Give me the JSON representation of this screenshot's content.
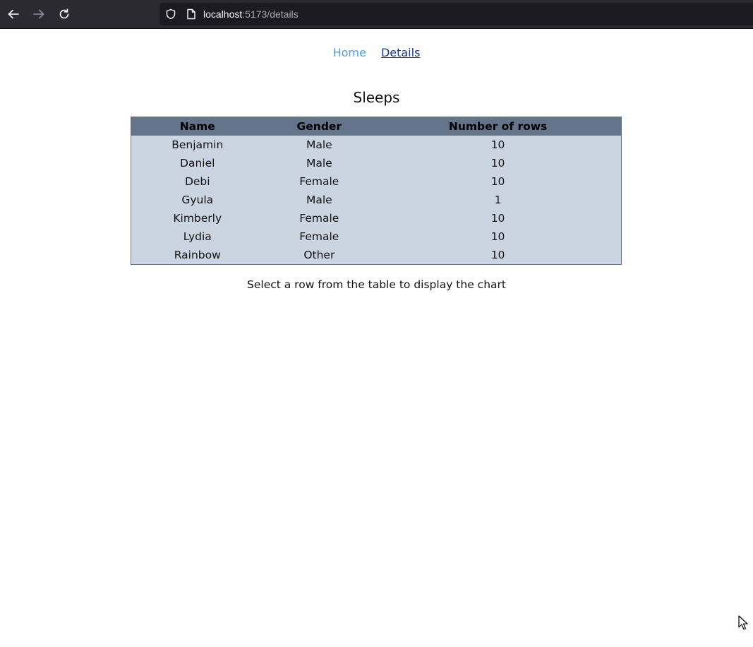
{
  "browser": {
    "url_host": "localhost",
    "url_path": ":5173/details",
    "icons": {
      "back": "arrow-left-icon",
      "forward": "arrow-right-icon",
      "reload": "reload-icon",
      "shield": "shield-icon",
      "page": "page-icon"
    }
  },
  "nav": {
    "home_label": "Home",
    "details_label": "Details"
  },
  "main": {
    "title": "Sleeps",
    "table": {
      "headers": [
        "Name",
        "Gender",
        "Number of rows"
      ],
      "rows": [
        [
          "Benjamin",
          "Male",
          "10"
        ],
        [
          "Daniel",
          "Male",
          "10"
        ],
        [
          "Debi",
          "Female",
          "10"
        ],
        [
          "Gyula",
          "Male",
          "1"
        ],
        [
          "Kimberly",
          "Female",
          "10"
        ],
        [
          "Lydia",
          "Female",
          "10"
        ],
        [
          "Rainbow",
          "Other",
          "10"
        ]
      ]
    },
    "hint": "Select a row from the table to display the chart"
  },
  "colors": {
    "header_bg": "#64748b",
    "row_bg": "#cbd5e1",
    "link_home": "#4d9fe0",
    "link_details": "#1e3a8a"
  }
}
